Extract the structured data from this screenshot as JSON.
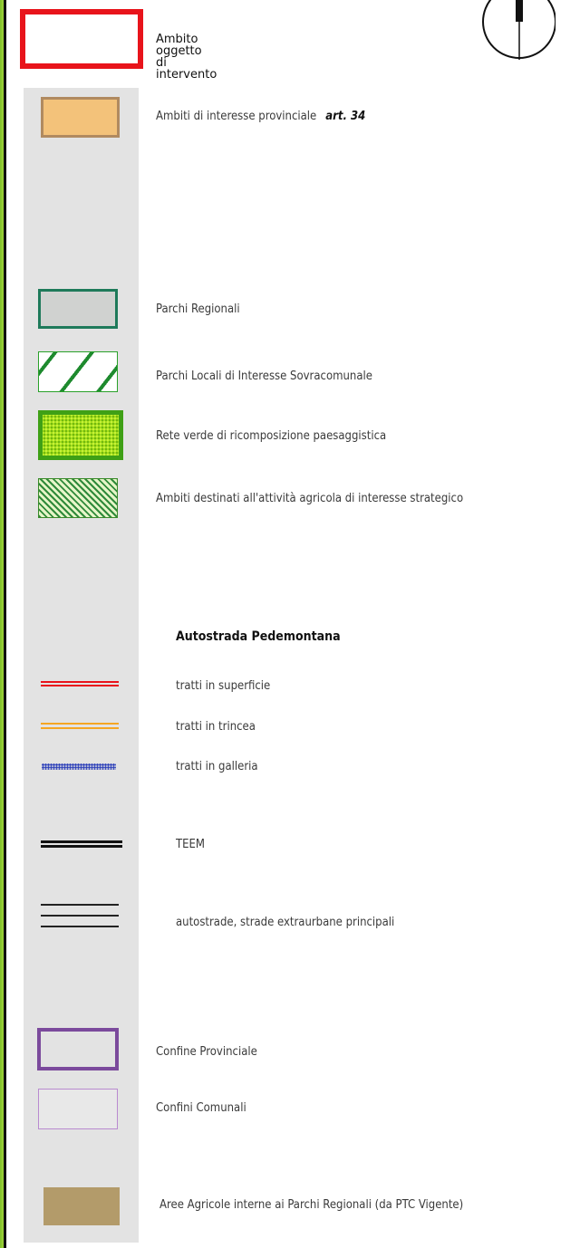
{
  "legend": {
    "ambito_lines": [
      "Ambito",
      "oggetto",
      "di",
      "intervento"
    ],
    "items": [
      {
        "label": "Ambiti di interesse provinciale",
        "art": "art. 34"
      },
      {
        "label": "Parchi Regionali"
      },
      {
        "label": "Parchi Locali di Interesse Sovracomunale"
      },
      {
        "label": "Rete verde di ricomposizione paesaggistica"
      },
      {
        "label": "Ambiti destinati all'attività agricola di interesse strategico"
      }
    ],
    "pedemontana": {
      "heading": "Autostrada Pedemontana",
      "superficie": "tratti in superficie",
      "trincea": "tratti in trincea",
      "galleria": "tratti in galleria"
    },
    "teem": "TEEM",
    "autostrade": "autostrade, strade extraurbane principali",
    "confine_provinciale": "Confine Provinciale",
    "confini_comunali": "Confini Comunali",
    "aree_agricole": "Aree Agricole interne ai Parchi Regionali (da PTC Vigente)"
  },
  "colors": {
    "ambito_border": "#e8141b",
    "provinciale_fill": "#f3c27a",
    "parchi_regionali_border": "#1e7a5a",
    "rete_verde_fill": "#a5e018",
    "pedemontana_superficie": "#e8141b",
    "pedemontana_trincea": "#f5a623",
    "pedemontana_galleria": "#2c3fb8",
    "confine_provinciale": "#7b4a9c",
    "confini_comunali": "#b98ad0",
    "aree_agricole_fill": "#b39b6a"
  },
  "icons": [
    "north-arrow-icon"
  ]
}
